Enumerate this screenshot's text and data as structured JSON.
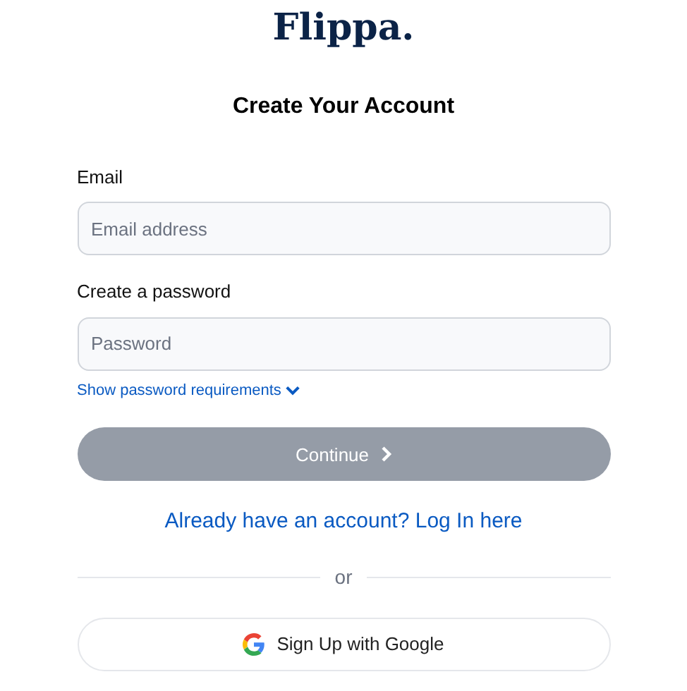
{
  "logo": "Flippa.",
  "title": "Create Your Account",
  "fields": [
    {
      "label": "Email",
      "placeholder": "Email address"
    },
    {
      "label": "Create a password",
      "placeholder": "Password"
    }
  ],
  "password_requirements": {
    "label": "Show password requirements",
    "expanded": false
  },
  "continue_button": {
    "label": "Continue",
    "disabled": true
  },
  "login_link": "Already have an account? Log In here",
  "divider": "or",
  "google_button": "Sign Up with Google"
}
